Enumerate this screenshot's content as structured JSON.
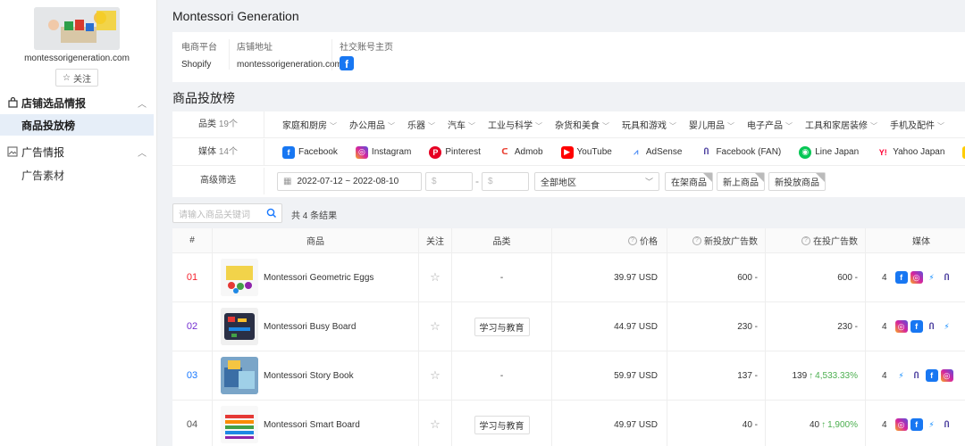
{
  "sidebar": {
    "shop_domain": "montessorigeneration.com",
    "follow_label": "关注",
    "groups": [
      {
        "label": "店铺选品情报",
        "items": [
          {
            "label": "商品投放榜",
            "active": true
          }
        ]
      },
      {
        "label": "广告情报",
        "items": [
          {
            "label": "广告素材",
            "active": false
          }
        ]
      }
    ]
  },
  "header": {
    "title": "Montessori Generation"
  },
  "shop_info": {
    "platform_label": "电商平台",
    "platform_value": "Shopify",
    "address_label": "店铺地址",
    "address_value": "montessorigeneration.com",
    "social_label": "社交账号主页",
    "social_icon": "facebook-icon"
  },
  "section_title": "商品投放榜",
  "filters": {
    "category_label": "品类",
    "category_count": "19个",
    "categories": [
      "家庭和厨房",
      "办公用品",
      "乐器",
      "汽车",
      "工业与科学",
      "杂货和美食",
      "玩具和游戏",
      "婴儿用品",
      "电子产品",
      "工具和家居装修",
      "手机及配件"
    ],
    "media_label": "媒体",
    "media_count": "14个",
    "media": [
      {
        "name": "Facebook",
        "icon": "facebook-icon",
        "color": "#1877f2"
      },
      {
        "name": "Instagram",
        "icon": "instagram-icon",
        "color": "#d6249f"
      },
      {
        "name": "Pinterest",
        "icon": "pinterest-icon",
        "color": "#e60023"
      },
      {
        "name": "Admob",
        "icon": "admob-icon",
        "color": "#ea4335"
      },
      {
        "name": "YouTube",
        "icon": "youtube-icon",
        "color": "#ff0000"
      },
      {
        "name": "AdSense",
        "icon": "adsense-icon",
        "color": "#fbbc04"
      },
      {
        "name": "Facebook (FAN)",
        "icon": "audience-network-icon",
        "color": "#4a3d9e"
      },
      {
        "name": "Line Japan",
        "icon": "line-icon",
        "color": "#06c755"
      },
      {
        "name": "Yahoo Japan",
        "icon": "yahoo-icon",
        "color": "#ff0033"
      },
      {
        "name": "TopBuzz J",
        "icon": "topbuzz-icon",
        "color": "#ffcc00"
      }
    ],
    "advanced_label": "高级筛选",
    "date_range": "2022-07-12 ~ 2022-08-10",
    "price_min_placeholder": "$",
    "price_sep": "-",
    "price_max_placeholder": "$",
    "region_value": "全部地区",
    "toggles": [
      "在架商品",
      "新上商品",
      "新投放商品"
    ]
  },
  "search": {
    "placeholder": "请输入商品关键词",
    "result_text": "共 4 条结果"
  },
  "table": {
    "headers": {
      "idx": "#",
      "product": "商品",
      "follow": "关注",
      "category": "品类",
      "price": "价格",
      "new_ads": "新投放广告数",
      "active_ads": "在投广告数",
      "media": "媒体"
    },
    "rows": [
      {
        "idx": "01",
        "idx_color": "#f5222d",
        "name": "Montessori Geometric Eggs",
        "category": "-",
        "category_is_tag": false,
        "price": "39.97 USD",
        "new_ads": "600 -",
        "active_ads": "600 -",
        "active_growth": "",
        "media_count": "4",
        "media_icons": [
          "facebook-icon",
          "instagram-icon",
          "messenger-icon",
          "audience-network-icon"
        ]
      },
      {
        "idx": "02",
        "idx_color": "#722ed1",
        "name": "Montessori Busy Board",
        "category": "学习与教育",
        "category_is_tag": true,
        "price": "44.97 USD",
        "new_ads": "230 -",
        "active_ads": "230 -",
        "active_growth": "",
        "media_count": "4",
        "media_icons": [
          "instagram-icon",
          "facebook-icon",
          "audience-network-icon",
          "messenger-icon"
        ]
      },
      {
        "idx": "03",
        "idx_color": "#1677ff",
        "name": "Montessori Story Book",
        "category": "-",
        "category_is_tag": false,
        "price": "59.97 USD",
        "new_ads": "137 -",
        "active_ads": "139",
        "active_growth": "4,533.33%",
        "media_count": "4",
        "media_icons": [
          "messenger-icon",
          "audience-network-icon",
          "facebook-icon",
          "instagram-icon"
        ]
      },
      {
        "idx": "04",
        "idx_color": "#555555",
        "name": "Montessori Smart Board",
        "category": "学习与教育",
        "category_is_tag": true,
        "price": "49.97 USD",
        "new_ads": "40 -",
        "active_ads": "40",
        "active_growth": "1,900%",
        "media_count": "4",
        "media_icons": [
          "instagram-icon",
          "facebook-icon",
          "messenger-icon",
          "audience-network-icon"
        ]
      }
    ]
  }
}
